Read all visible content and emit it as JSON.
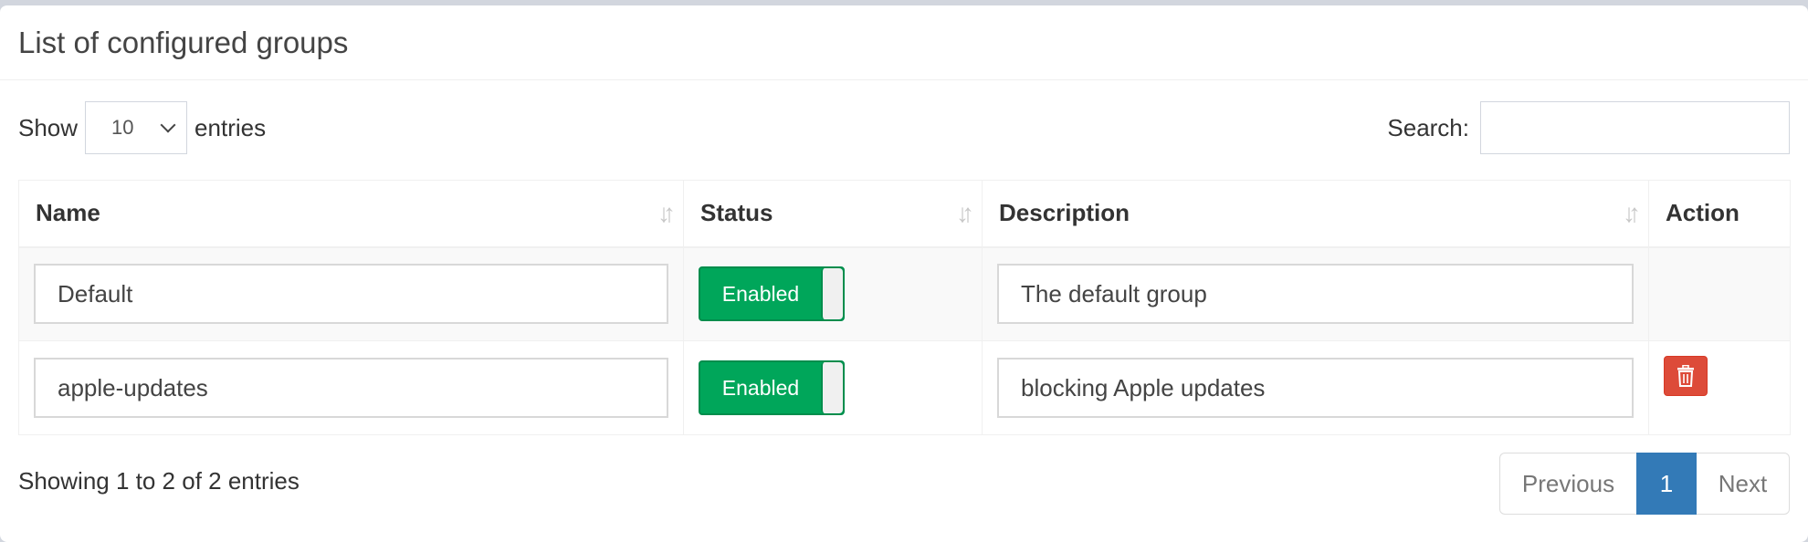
{
  "box": {
    "title": "List of configured groups"
  },
  "controls": {
    "show_label": "Show",
    "page_size": "10",
    "entries_label": "entries",
    "search_label": "Search:",
    "search_value": ""
  },
  "table": {
    "columns": [
      "Name",
      "Status",
      "Description",
      "Action"
    ],
    "rows": [
      {
        "name": "Default",
        "status": "Enabled",
        "description": "The default group",
        "deletable": false
      },
      {
        "name": "apple-updates",
        "status": "Enabled",
        "description": "blocking Apple updates",
        "deletable": true
      }
    ]
  },
  "footer": {
    "info": "Showing 1 to 2 of 2 entries",
    "prev": "Previous",
    "page": "1",
    "next": "Next"
  },
  "colors": {
    "enabled_toggle": "#00a65a",
    "delete_button": "#dd4b39",
    "active_page": "#337ab7"
  },
  "icons": {
    "sort": "sort-icon",
    "delete": "trash-icon",
    "dropdown": "chevron-down-icon"
  }
}
